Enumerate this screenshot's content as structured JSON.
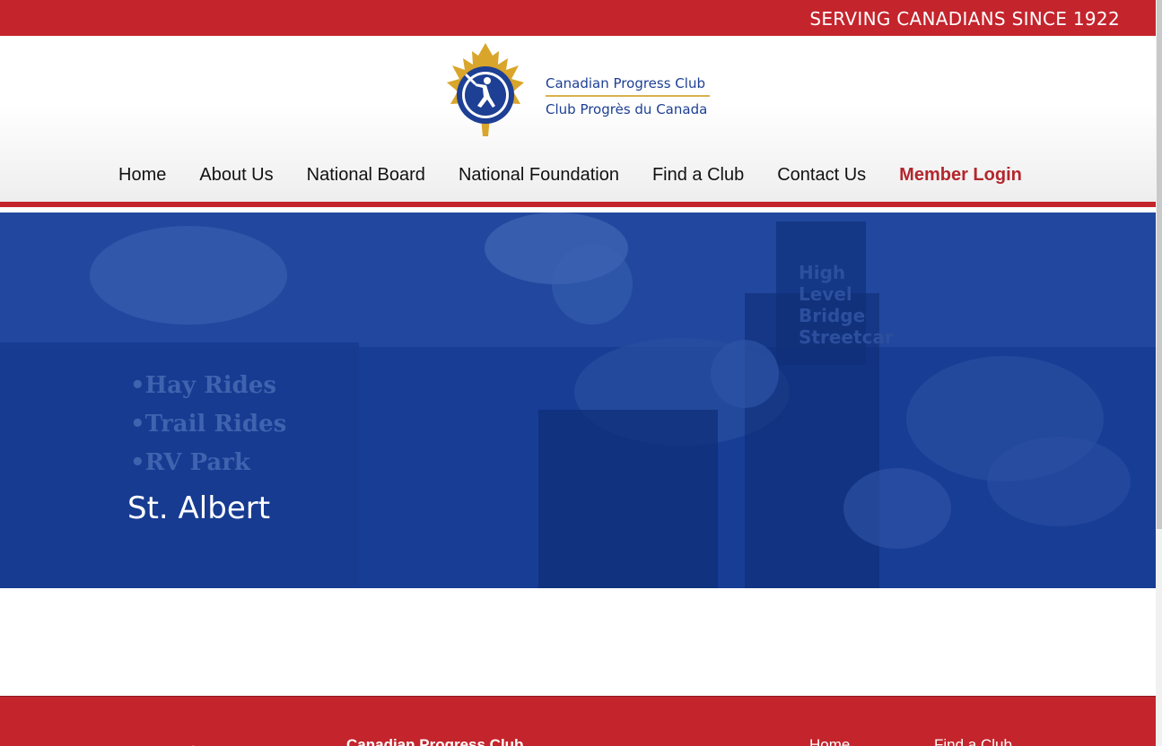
{
  "topbar": {
    "tagline": "SERVING CANADIANS SINCE 1922"
  },
  "logo": {
    "line1": "Canadian Progress Club",
    "line2": "Club Progrès du Canada",
    "icon": "maple-leaf-runner-logo-icon"
  },
  "nav": {
    "items": [
      {
        "label": "Home"
      },
      {
        "label": "About Us"
      },
      {
        "label": "National Board"
      },
      {
        "label": "National Foundation"
      },
      {
        "label": "Find a Club"
      },
      {
        "label": "Contact Us"
      },
      {
        "label": "Member Login"
      }
    ]
  },
  "hero": {
    "title": "St. Albert",
    "sign_lines": [
      "•Hay Rides",
      "•Trail Rides",
      "•RV Park"
    ],
    "sign_right": [
      "High",
      "Level",
      "Bridge",
      "Streetcar"
    ]
  },
  "footer": {
    "brand": "Canadian Progress Club",
    "links": [
      "Home",
      "Find a Club"
    ]
  },
  "colors": {
    "brand_red": "#c4242c",
    "brand_blue": "#173d95",
    "logo_gold": "#d9a52a",
    "logo_navy": "#1d3f94"
  }
}
